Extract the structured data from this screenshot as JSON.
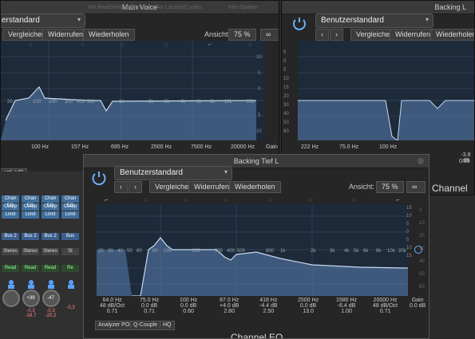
{
  "back_window_left": {
    "title": "Main Voice",
    "preset": "erstandard",
    "buttons": [
      "Vergleichen",
      "Widerrufen",
      "Wiederholen"
    ],
    "view_label": "Ansicht:",
    "zoom": "75 %",
    "freq_labels": [
      "20",
      "50",
      "100",
      "200",
      "300",
      "400",
      "500",
      "800",
      "1k",
      "2k",
      "3k",
      "4k",
      "6k",
      "8k",
      "10k",
      "20k"
    ],
    "db_labels": [
      "15",
      "10",
      "5",
      "0",
      "5",
      "10",
      "15"
    ],
    "band_freqs": [
      "100 Hz",
      "157 Hz",
      "695 Hz",
      "2500 Hz",
      "7500 Hz",
      "20000 Hz"
    ],
    "gain_label": "Gain",
    "chip_labels": [
      "uple",
      "HQ"
    ],
    "faded_menu": [
      "Mit Bearbeitungsfenster",
      "An Locator/Cycles",
      "Info-Spalten"
    ]
  },
  "back_window_right": {
    "title": "Backing L",
    "preset": "Benutzerstandard",
    "buttons": [
      "Vergleichen",
      "Widerrufen",
      "Wiederholen"
    ],
    "db_labels": [
      "5",
      "0",
      "5",
      "10",
      "15",
      "20",
      "30",
      "40",
      "50",
      "60"
    ],
    "band_freqs": [
      "222 Hz",
      "75.0 Hz",
      "100 Hz"
    ],
    "band_gain": "-3.8 dB",
    "band_q": "0.89",
    "section_label": "Channel EQ"
  },
  "front_window": {
    "title": "Backing Tief L",
    "preset": "Benutzerstandard",
    "buttons": [
      "Vergleichen",
      "Widerrufen",
      "Wiederholen"
    ],
    "view_label": "Ansicht:",
    "zoom": "75 %",
    "freq_labels": [
      "20",
      "30",
      "40",
      "50",
      "60",
      "80",
      "100",
      "200",
      "300",
      "400",
      "500",
      "800",
      "1k",
      "2k",
      "3k",
      "4k",
      "5k",
      "6k",
      "8k",
      "10k",
      "20k"
    ],
    "db_labels": [
      "15",
      "10",
      "5",
      "0",
      "5",
      "10",
      "15"
    ],
    "right_db_labels": [
      "0",
      "10",
      "20",
      "30",
      "40",
      "50",
      "60"
    ],
    "bands": [
      {
        "freq": "64.0 Hz",
        "gain": "48 dB/Oct",
        "q": "0.71"
      },
      {
        "freq": "75.0 Hz",
        "gain": "0.0 dB",
        "q": "0.71"
      },
      {
        "freq": "100 Hz",
        "gain": "0.0 dB",
        "q": "0.60"
      },
      {
        "freq": "87.0 Hz",
        "gain": "+4.0 dB",
        "q": "2.80"
      },
      {
        "freq": "418 Hz",
        "gain": "-4.4 dB",
        "q": "2.50"
      },
      {
        "freq": "2500 Hz",
        "gain": "0.0 dB",
        "q": "13.0"
      },
      {
        "freq": "1580 Hz",
        "gain": "-6.4 dB",
        "q": "1.00"
      },
      {
        "freq": "20000 Hz",
        "gain": "48 dB/Oct",
        "q": "0.71"
      }
    ],
    "gain_label": "Gain",
    "gain_value": "0.0 dB",
    "chips": [
      "Analyzer POST",
      "Q-Couple",
      "HQ"
    ],
    "footer_title": "Channel EQ"
  },
  "mixer": {
    "strips": [
      {
        "eq": "Chan EQ",
        "comp": "Comp",
        "limit": "Limit",
        "bus": "Bus 2",
        "stereo": "Stereo",
        "read": "Read",
        "knob": "",
        "vals": ""
      },
      {
        "eq": "Chan EQ",
        "comp": "Comp",
        "limit": "Limit",
        "bus": "Bus 2",
        "stereo": "Stereo",
        "read": "Read",
        "knob": "+39",
        "vals": "-0,3  -18,7"
      },
      {
        "eq": "Chan EQ",
        "comp": "Comp",
        "limit": "Limit",
        "bus": "Bus 2",
        "stereo": "Stereo",
        "read": "Read",
        "knob": "-47",
        "vals": "-0,3  -20,2"
      },
      {
        "eq": "Chan EQ",
        "comp": "Comp",
        "limit": "Limit",
        "bus": "Bus",
        "stereo": "St",
        "read": "Re",
        "knob": "",
        "vals": "-0,3"
      }
    ]
  }
}
